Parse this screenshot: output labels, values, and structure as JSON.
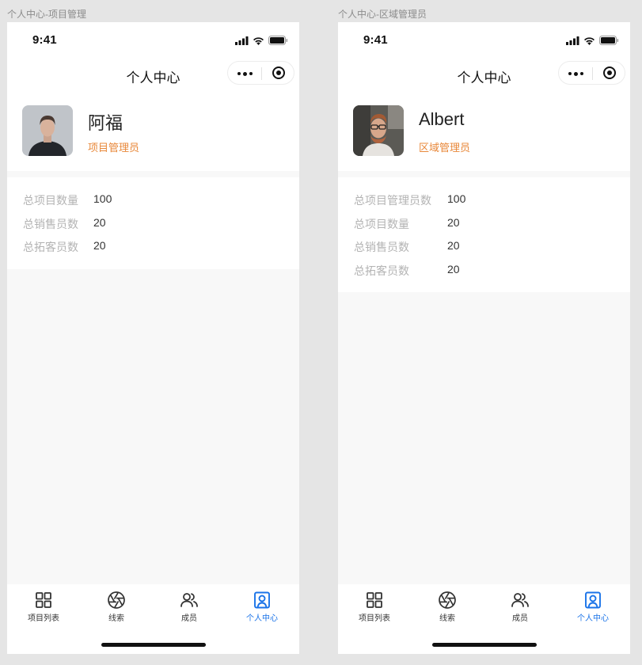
{
  "screens": [
    {
      "label": "个人中心-项目管理",
      "status_time": "9:41",
      "nav_title": "个人中心",
      "user": {
        "name": "阿福",
        "role": "项目管理员"
      },
      "stats": [
        {
          "label": "总项目数量",
          "value": "100"
        },
        {
          "label": "总销售员数",
          "value": "20"
        },
        {
          "label": "总拓客员数",
          "value": "20"
        }
      ],
      "tabs": [
        {
          "label": "项目列表",
          "icon": "grid-icon"
        },
        {
          "label": "线索",
          "icon": "aperture-icon"
        },
        {
          "label": "成员",
          "icon": "users-icon"
        },
        {
          "label": "个人中心",
          "icon": "user-badge-icon",
          "active": true
        }
      ]
    },
    {
      "label": "个人中心-区域管理员",
      "status_time": "9:41",
      "nav_title": "个人中心",
      "user": {
        "name": "Albert",
        "role": "区域管理员"
      },
      "stats": [
        {
          "label": "总项目管理员数",
          "value": "100"
        },
        {
          "label": "总项目数量",
          "value": "20"
        },
        {
          "label": "总销售员数",
          "value": "20"
        },
        {
          "label": "总拓客员数",
          "value": "20"
        }
      ],
      "tabs": [
        {
          "label": "项目列表",
          "icon": "grid-icon"
        },
        {
          "label": "线索",
          "icon": "aperture-icon"
        },
        {
          "label": "成员",
          "icon": "users-icon"
        },
        {
          "label": "个人中心",
          "icon": "user-badge-icon",
          "active": true
        }
      ]
    }
  ],
  "colors": {
    "accent": "#1a73e8",
    "role": "#e8883a",
    "label_gray": "#b3b3b3",
    "page_bg": "#f8f8f8"
  }
}
